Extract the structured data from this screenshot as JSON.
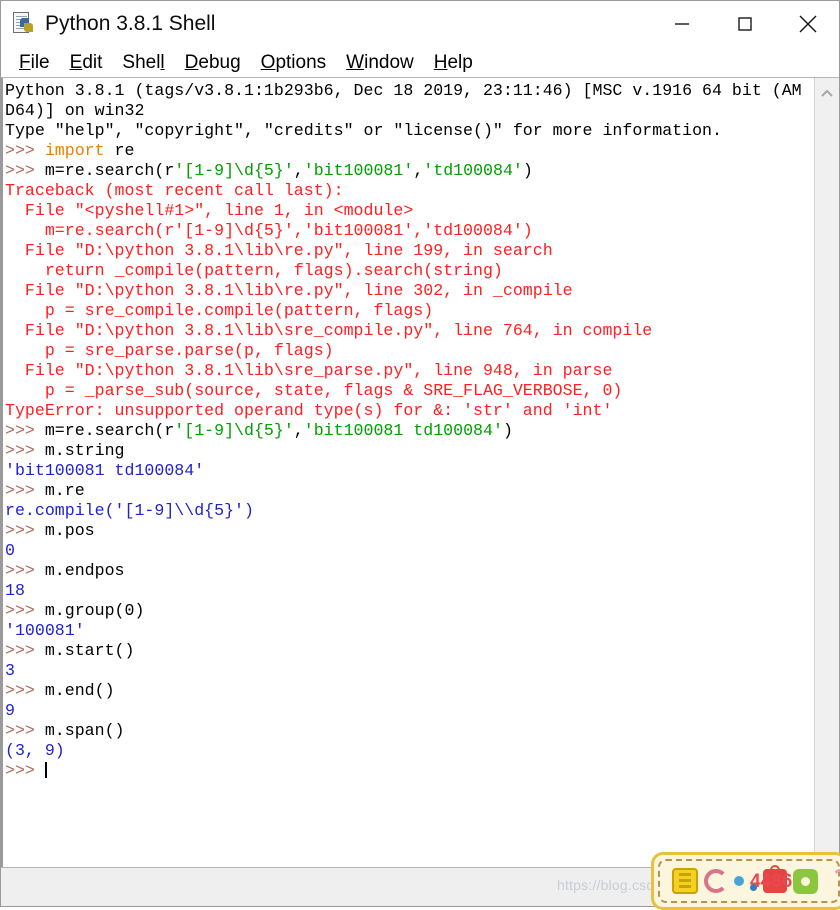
{
  "window": {
    "title": "Python 3.8.1 Shell",
    "icon": "python-idle-icon",
    "controls": {
      "minimize": "minimize-icon",
      "maximize": "maximize-icon",
      "close": "close-icon"
    }
  },
  "menubar": {
    "items": [
      {
        "label": "File",
        "accel": "F",
        "rest": "ile"
      },
      {
        "label": "Edit",
        "accel": "E",
        "rest": "dit"
      },
      {
        "label": "Shell",
        "accel": "Shel",
        "rest": "l",
        "underline_last": true
      },
      {
        "label": "Debug",
        "accel": "D",
        "rest": "ebug"
      },
      {
        "label": "Options",
        "accel": "O",
        "rest": "ptions"
      },
      {
        "label": "Window",
        "accel": "W",
        "rest": "indow"
      },
      {
        "label": "Help",
        "accel": "H",
        "rest": "elp"
      }
    ]
  },
  "shell": {
    "lines": [
      {
        "segments": [
          {
            "t": "Python 3.8.1 (tags/v3.8.1:1b293b6, Dec 18 2019, 23:11:46) [MSC v.1916 64 bit (AM",
            "c": "plain"
          }
        ]
      },
      {
        "segments": [
          {
            "t": "D64)] on win32",
            "c": "plain"
          }
        ]
      },
      {
        "segments": [
          {
            "t": "Type \"help\", \"copyright\", \"credits\" or \"license()\" for more information.",
            "c": "plain"
          }
        ]
      },
      {
        "segments": [
          {
            "t": ">>> ",
            "c": "prompt"
          },
          {
            "t": "import",
            "c": "kw"
          },
          {
            "t": " re",
            "c": "plain"
          }
        ]
      },
      {
        "segments": [
          {
            "t": ">>> ",
            "c": "prompt"
          },
          {
            "t": "m=re.search(r",
            "c": "plain"
          },
          {
            "t": "'[1-9]\\d{5}'",
            "c": "str"
          },
          {
            "t": ",",
            "c": "plain"
          },
          {
            "t": "'bit100081'",
            "c": "str"
          },
          {
            "t": ",",
            "c": "plain"
          },
          {
            "t": "'td100084'",
            "c": "str"
          },
          {
            "t": ")",
            "c": "plain"
          }
        ]
      },
      {
        "segments": [
          {
            "t": "Traceback (most recent call last):",
            "c": "err"
          }
        ]
      },
      {
        "segments": [
          {
            "t": "  File \"<pyshell#1>\", line 1, in <module>",
            "c": "err"
          }
        ]
      },
      {
        "segments": [
          {
            "t": "    m=re.search(r'[1-9]\\d{5}','bit100081','td100084')",
            "c": "err"
          }
        ]
      },
      {
        "segments": [
          {
            "t": "  File \"D:\\python 3.8.1\\lib\\re.py\", line 199, in search",
            "c": "err"
          }
        ]
      },
      {
        "segments": [
          {
            "t": "    return _compile(pattern, flags).search(string)",
            "c": "err"
          }
        ]
      },
      {
        "segments": [
          {
            "t": "  File \"D:\\python 3.8.1\\lib\\re.py\", line 302, in _compile",
            "c": "err"
          }
        ]
      },
      {
        "segments": [
          {
            "t": "    p = sre_compile.compile(pattern, flags)",
            "c": "err"
          }
        ]
      },
      {
        "segments": [
          {
            "t": "  File \"D:\\python 3.8.1\\lib\\sre_compile.py\", line 764, in compile",
            "c": "err"
          }
        ]
      },
      {
        "segments": [
          {
            "t": "    p = sre_parse.parse(p, flags)",
            "c": "err"
          }
        ]
      },
      {
        "segments": [
          {
            "t": "  File \"D:\\python 3.8.1\\lib\\sre_parse.py\", line 948, in parse",
            "c": "err"
          }
        ]
      },
      {
        "segments": [
          {
            "t": "    p = _parse_sub(source, state, flags & SRE_FLAG_VERBOSE, 0)",
            "c": "err"
          }
        ]
      },
      {
        "segments": [
          {
            "t": "TypeError: unsupported operand type(s) for &: 'str' and 'int'",
            "c": "err"
          }
        ]
      },
      {
        "segments": [
          {
            "t": ">>> ",
            "c": "prompt"
          },
          {
            "t": "m=re.search(r",
            "c": "plain"
          },
          {
            "t": "'[1-9]\\d{5}'",
            "c": "str"
          },
          {
            "t": ",",
            "c": "plain"
          },
          {
            "t": "'bit100081 td100084'",
            "c": "str"
          },
          {
            "t": ")",
            "c": "plain"
          }
        ]
      },
      {
        "segments": [
          {
            "t": ">>> ",
            "c": "prompt"
          },
          {
            "t": "m.string",
            "c": "plain"
          }
        ]
      },
      {
        "segments": [
          {
            "t": "'bit100081 td100084'",
            "c": "out"
          }
        ]
      },
      {
        "segments": [
          {
            "t": ">>> ",
            "c": "prompt"
          },
          {
            "t": "m.re",
            "c": "plain"
          }
        ]
      },
      {
        "segments": [
          {
            "t": "re.compile('[1-9]\\\\d{5}')",
            "c": "out"
          }
        ]
      },
      {
        "segments": [
          {
            "t": ">>> ",
            "c": "prompt"
          },
          {
            "t": "m.pos",
            "c": "plain"
          }
        ]
      },
      {
        "segments": [
          {
            "t": "0",
            "c": "out"
          }
        ]
      },
      {
        "segments": [
          {
            "t": ">>> ",
            "c": "prompt"
          },
          {
            "t": "m.endpos",
            "c": "plain"
          }
        ]
      },
      {
        "segments": [
          {
            "t": "18",
            "c": "out"
          }
        ]
      },
      {
        "segments": [
          {
            "t": ">>> ",
            "c": "prompt"
          },
          {
            "t": "m.group(0)",
            "c": "plain"
          }
        ]
      },
      {
        "segments": [
          {
            "t": "'100081'",
            "c": "out"
          }
        ]
      },
      {
        "segments": [
          {
            "t": ">>> ",
            "c": "prompt"
          },
          {
            "t": "m.start()",
            "c": "plain"
          }
        ]
      },
      {
        "segments": [
          {
            "t": "3",
            "c": "out"
          }
        ]
      },
      {
        "segments": [
          {
            "t": ">>> ",
            "c": "prompt"
          },
          {
            "t": "m.end()",
            "c": "plain"
          }
        ]
      },
      {
        "segments": [
          {
            "t": "9",
            "c": "out"
          }
        ]
      },
      {
        "segments": [
          {
            "t": ">>> ",
            "c": "prompt"
          },
          {
            "t": "m.span()",
            "c": "plain"
          }
        ]
      },
      {
        "segments": [
          {
            "t": "(3, 9)",
            "c": "out"
          }
        ]
      },
      {
        "segments": [
          {
            "t": ">>> ",
            "c": "prompt"
          },
          {
            "caret": true
          }
        ]
      }
    ]
  },
  "scrollbar": {
    "up_arrow": "chevron-up-icon"
  },
  "watermark": {
    "text": "https://blog.csdn.net/"
  },
  "badge": {
    "number": "4486",
    "icons": [
      "flower-icon",
      "c-icon",
      "dot-icon",
      "small-dot-icon",
      "bag-icon",
      "gear-icon"
    ]
  },
  "colors": {
    "prompt": "#b06a5a",
    "keyword": "#f08000",
    "string": "#00a000",
    "error": "#ff2020",
    "output": "#2222cc",
    "text": "#000000"
  }
}
